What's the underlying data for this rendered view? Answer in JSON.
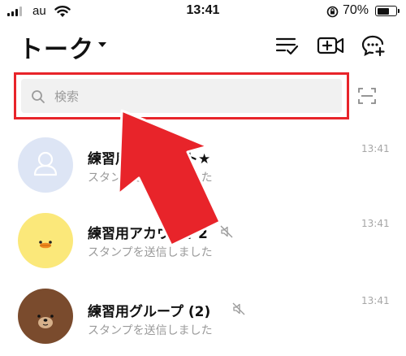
{
  "status_bar": {
    "carrier": "au",
    "time": "13:41",
    "battery_percent_label": "70%",
    "battery_level": 0.7
  },
  "header": {
    "title": "トーク"
  },
  "search": {
    "placeholder": "検索"
  },
  "chats": [
    {
      "name": "練習用アカウント★",
      "preview": "スタンプを送信しました",
      "time": "13:41",
      "muted": false,
      "avatar": "default-person-icon"
    },
    {
      "name": "練習用アカウント2",
      "preview": "スタンプを送信しました",
      "time": "13:41",
      "muted": true,
      "avatar": "sally-chick-avatar"
    },
    {
      "name": "練習用グループ (2)",
      "preview": "スタンプを送信しました",
      "time": "13:41",
      "muted": true,
      "avatar": "brown-bear-avatar"
    }
  ],
  "annotation": {
    "highlight_color": "#e8242a",
    "arrow_color": "#e8242a"
  }
}
